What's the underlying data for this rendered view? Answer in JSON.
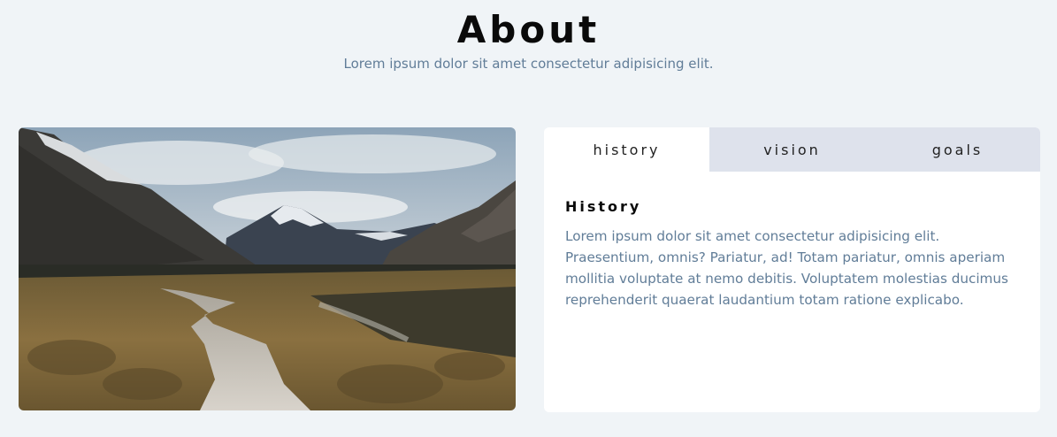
{
  "header": {
    "title": "About",
    "subtitle": "Lorem ipsum dolor sit amet consectetur adipisicing elit."
  },
  "tabs": [
    {
      "label": "history",
      "active": true
    },
    {
      "label": "vision",
      "active": false
    },
    {
      "label": "goals",
      "active": false
    }
  ],
  "content": {
    "title": "History",
    "text": "Lorem ipsum dolor sit amet consectetur adipisicing elit. Praesentium, omnis? Pariatur, ad! Totam pariatur, omnis aperiam mollitia voluptate at nemo debitis. Voluptatem molestias ducimus reprehenderit quaerat laudantium totam ratione explicabo."
  },
  "colors": {
    "background": "#f0f4f7",
    "tab_inactive": "#dee2ec",
    "text_muted": "#617d98"
  }
}
